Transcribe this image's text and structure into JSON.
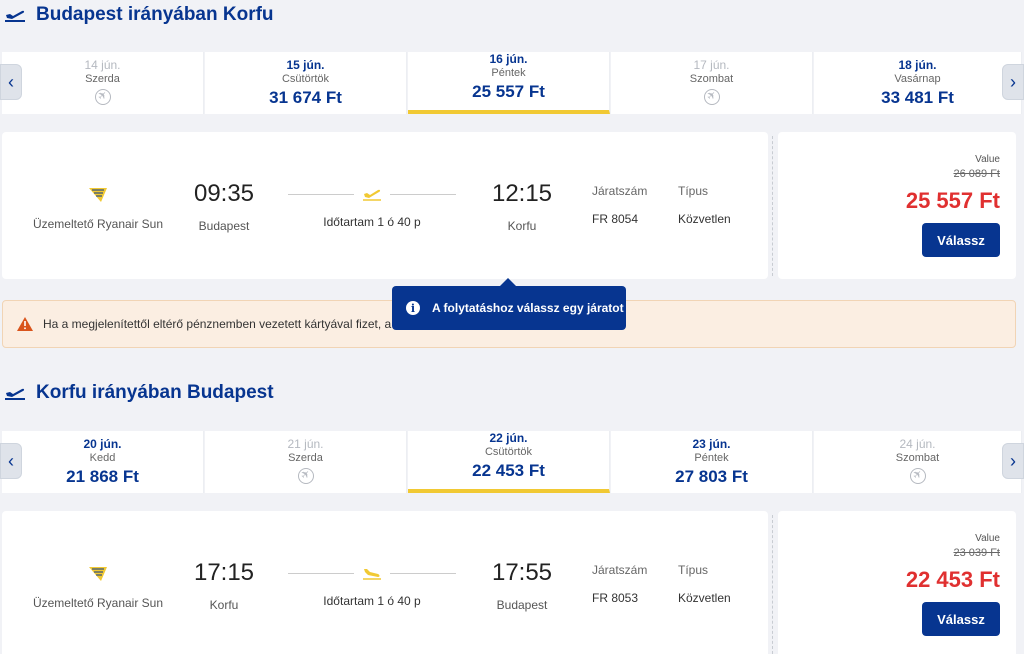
{
  "outbound": {
    "title": "Budapest irányában Korfu",
    "dates": [
      {
        "date": "14 jún.",
        "weekday": "Szerda",
        "price": null,
        "available": false
      },
      {
        "date": "15 jún.",
        "weekday": "Csütörtök",
        "price": "31 674 Ft",
        "available": true
      },
      {
        "date": "16 jún.",
        "weekday": "Péntek",
        "price": "25 557 Ft",
        "available": true,
        "selected": true
      },
      {
        "date": "17 jún.",
        "weekday": "Szombat",
        "price": null,
        "available": false
      },
      {
        "date": "18 jún.",
        "weekday": "Vasárnap",
        "price": "33 481 Ft",
        "available": true
      }
    ],
    "flight": {
      "operator": "Üzemeltető Ryanair Sun",
      "dep_time": "09:35",
      "dep_city": "Budapest",
      "duration": "Időtartam 1 ó 40 p",
      "arr_time": "12:15",
      "arr_city": "Korfu",
      "flight_no_label": "Járatszám",
      "flight_no": "FR 8054",
      "type_label": "Típus",
      "type": "Közvetlen",
      "fare_label": "Value",
      "old_price": "26 089 Ft",
      "price": "25 557 Ft",
      "select_label": "Válassz"
    }
  },
  "alert": {
    "message": "Ha a megjelenítettől eltérő pénznemben vezetett kártyával fizet, a"
  },
  "tooltip": {
    "text": "A folytatáshoz válassz egy járatot"
  },
  "inbound": {
    "title": "Korfu irányában Budapest",
    "dates": [
      {
        "date": "20 jún.",
        "weekday": "Kedd",
        "price": "21 868 Ft",
        "available": true
      },
      {
        "date": "21 jún.",
        "weekday": "Szerda",
        "price": null,
        "available": false
      },
      {
        "date": "22 jún.",
        "weekday": "Csütörtök",
        "price": "22 453 Ft",
        "available": true,
        "selected": true
      },
      {
        "date": "23 jún.",
        "weekday": "Péntek",
        "price": "27 803 Ft",
        "available": true
      },
      {
        "date": "24 jún.",
        "weekday": "Szombat",
        "price": null,
        "available": false
      }
    ],
    "flight": {
      "operator": "Üzemeltető Ryanair Sun",
      "dep_time": "17:15",
      "dep_city": "Korfu",
      "duration": "Időtartam 1 ó 40 p",
      "arr_time": "17:55",
      "arr_city": "Budapest",
      "flight_no_label": "Járatszám",
      "flight_no": "FR 8053",
      "type_label": "Típus",
      "type": "Közvetlen",
      "fare_label": "Value",
      "old_price": "23 039 Ft",
      "price": "22 453 Ft",
      "select_label": "Válassz"
    }
  },
  "colors": {
    "brand": "#073590",
    "accent": "#f1c933",
    "price_red": "#e03030"
  },
  "icons": {
    "section": "plane-takeoff-icon",
    "prev": "chevron-left-icon",
    "next": "chevron-right-icon",
    "no_flight": "no-flight-icon",
    "logo": "ryanair-harp-icon",
    "warning": "warning-icon",
    "info": "info-icon"
  }
}
